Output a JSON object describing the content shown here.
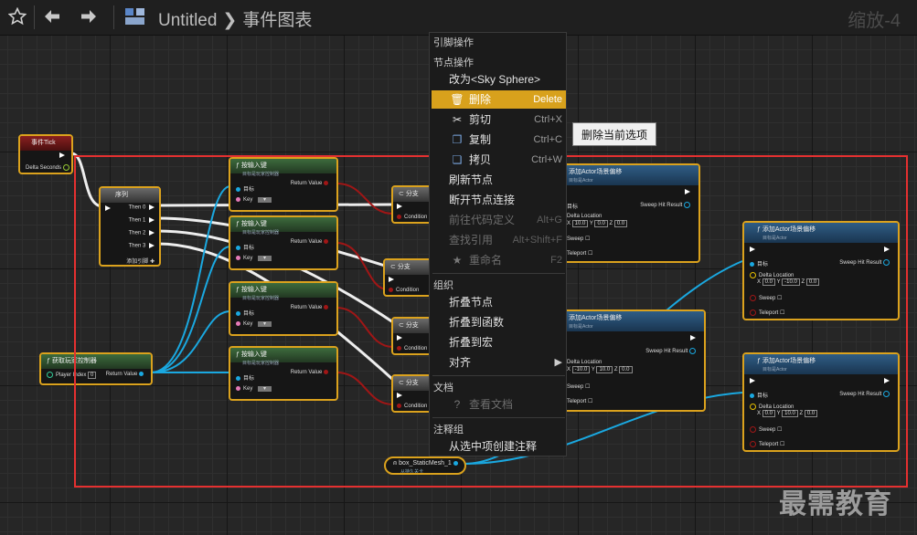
{
  "toolbar": {
    "app_title": "Untitled",
    "graph_title": "事件图表",
    "zoom": "缩放-4",
    "icons": [
      "star-icon",
      "back-arrow-icon",
      "forward-arrow-icon",
      "blueprint-icon"
    ]
  },
  "nodes": {
    "event_tick": {
      "title": "事件Tick",
      "pin_delta": "Delta Seconds"
    },
    "sequence": {
      "title": "序列",
      "pins": [
        "Then 0",
        "Then 1",
        "Then 2",
        "Then 3"
      ],
      "add_pin": "添加引脚"
    },
    "key_nodes": [
      {
        "title": "按输入键",
        "subtitle": "目标是玩家控制器",
        "target": "目标",
        "key": "Key",
        "return": "Return Value"
      },
      {
        "title": "按输入键",
        "subtitle": "目标是玩家控制器",
        "target": "目标",
        "key": "Key",
        "return": "Return Value"
      },
      {
        "title": "按输入键",
        "subtitle": "目标是玩家控制器",
        "target": "目标",
        "key": "Key",
        "return": "Return Value"
      },
      {
        "title": "按输入键",
        "subtitle": "目标是玩家控制器",
        "target": "目标",
        "key": "Key",
        "return": "Return Value"
      }
    ],
    "branches": [
      {
        "title": "分支",
        "condition": "Condition"
      },
      {
        "title": "分支",
        "condition": "Condition"
      },
      {
        "title": "分支",
        "condition": "Condition"
      },
      {
        "title": "分支",
        "condition": "Condition"
      }
    ],
    "get_controller": {
      "title": "获取玩家控制器",
      "player_index_label": "Player Index",
      "player_index_value": "0",
      "return": "Return Value"
    },
    "offset_nodes": [
      {
        "title": "添加Actor场景偏移",
        "subtitle": "目标是Actor",
        "target": "目标",
        "sweep_result": "Sweep Hit Result",
        "delta": "Delta Location",
        "x": "10.0",
        "y": "0.0",
        "z": "0.0",
        "sweep": "Sweep",
        "teleport": "Teleport"
      },
      {
        "title": "添加Actor场景偏移",
        "subtitle": "目标是Actor",
        "target": "目标",
        "sweep_result": "Sweep Hit Result",
        "delta": "Delta Location",
        "x": "0.0",
        "y": "-10.0",
        "z": "0.0",
        "sweep": "Sweep",
        "teleport": "Teleport"
      },
      {
        "title": "添加Actor场景偏移",
        "subtitle": "目标是Actor",
        "target": "目标",
        "sweep_result": "Sweep Hit Result",
        "delta": "Delta Location",
        "x": "-10.0",
        "y": "10.0",
        "z": "0.0",
        "sweep": "Sweep",
        "teleport": "Teleport"
      },
      {
        "title": "添加Actor场景偏移",
        "subtitle": "目标是Actor",
        "target": "目标",
        "sweep_result": "Sweep Hit Result",
        "delta": "Delta Location",
        "x": "0.0",
        "y": "10.0",
        "z": "0.0",
        "sweep": "Sweep",
        "teleport": "Teleport"
      }
    ],
    "mesh_ref": {
      "title": "box_StaticMesh_1",
      "subtitle": "从持久关卡"
    }
  },
  "menu": {
    "header": "引脚操作",
    "node_ops": "节点操作",
    "items_top": [
      {
        "label": "改为<Sky Sphere>",
        "shortcut": ""
      },
      {
        "label": "删除",
        "shortcut": "Delete",
        "icon": "trash-icon",
        "highlighted": true
      },
      {
        "label": "剪切",
        "shortcut": "Ctrl+X",
        "icon": "scissors-icon"
      },
      {
        "label": "复制",
        "shortcut": "Ctrl+C",
        "icon": "copy-icon"
      },
      {
        "label": "拷贝",
        "shortcut": "Ctrl+W",
        "icon": "duplicate-icon"
      },
      {
        "label": "刷新节点",
        "shortcut": ""
      },
      {
        "label": "断开节点连接",
        "shortcut": ""
      },
      {
        "label": "前往代码定义",
        "shortcut": "Alt+G",
        "disabled": true
      },
      {
        "label": "查找引用",
        "shortcut": "Alt+Shift+F",
        "disabled": true
      },
      {
        "label": "重命名",
        "shortcut": "F2",
        "icon": "star-icon",
        "disabled": true
      }
    ],
    "group_header": "组织",
    "items_group": [
      {
        "label": "折叠节点"
      },
      {
        "label": "折叠到函数"
      },
      {
        "label": "折叠到宏"
      },
      {
        "label": "对齐"
      }
    ],
    "doc_header": "文档",
    "doc_item": "查看文档",
    "comment_header": "注释组",
    "comment_item": "从选中项创建注释"
  },
  "tooltip": "删除当前选项",
  "watermark": "最需教育",
  "colors": {
    "accent": "#d8a11c",
    "selection": "#e53030",
    "exec": "#ffffff",
    "object": "#1aa8e0",
    "bool": "#9a1515",
    "vector": "#e8c100"
  }
}
